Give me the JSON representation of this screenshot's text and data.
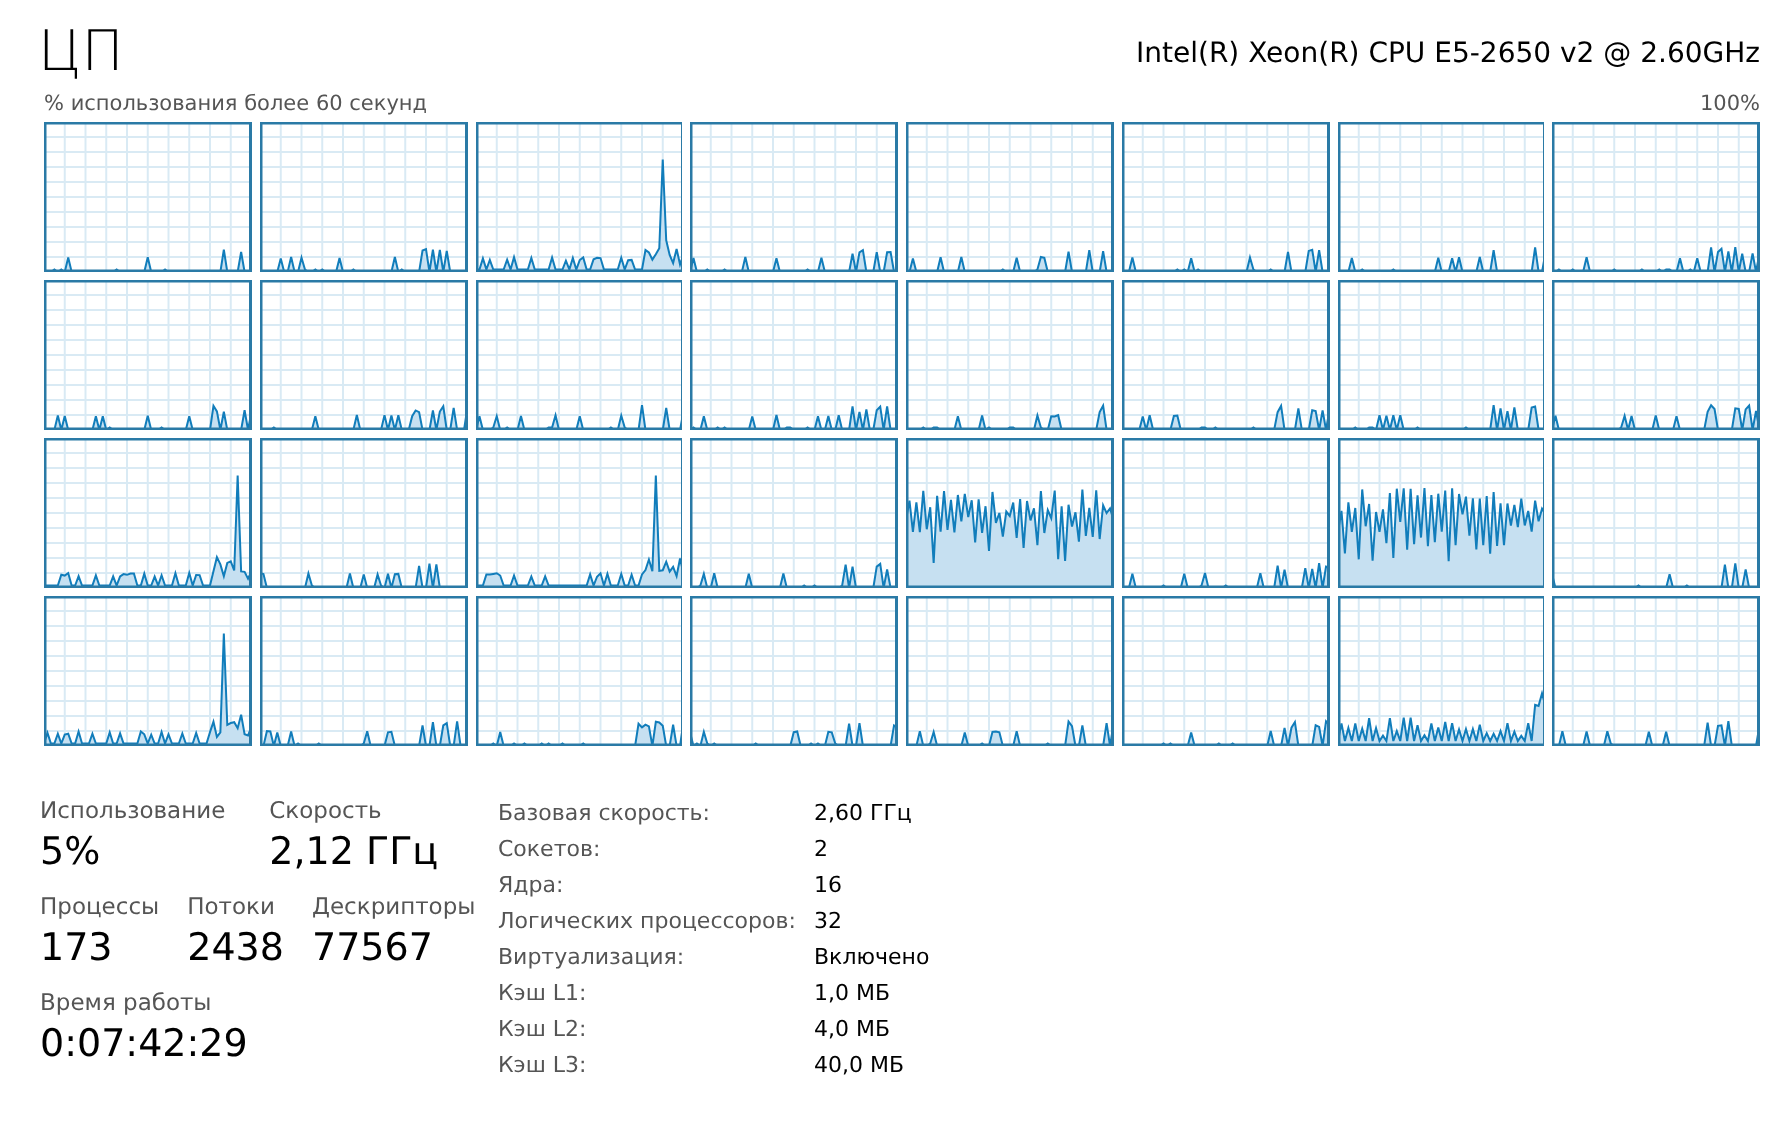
{
  "title": "ЦП",
  "cpu_name": "Intel(R) Xeon(R) CPU E5-2650 v2 @ 2.60GHz",
  "graph_caption": "% использования более 60 секунд",
  "graph_max": "100%",
  "cores": [
    {
      "kind": "quiet"
    },
    {
      "kind": "quiet"
    },
    {
      "kind": "spike"
    },
    {
      "kind": "quiet"
    },
    {
      "kind": "quiet"
    },
    {
      "kind": "quiet"
    },
    {
      "kind": "quiet"
    },
    {
      "kind": "quiet"
    },
    {
      "kind": "quiet"
    },
    {
      "kind": "quiet"
    },
    {
      "kind": "quiet"
    },
    {
      "kind": "quiet"
    },
    {
      "kind": "quiet"
    },
    {
      "kind": "quiet"
    },
    {
      "kind": "quiet"
    },
    {
      "kind": "quiet"
    },
    {
      "kind": "spike"
    },
    {
      "kind": "quiet"
    },
    {
      "kind": "spike"
    },
    {
      "kind": "quiet"
    },
    {
      "kind": "busy"
    },
    {
      "kind": "quiet"
    },
    {
      "kind": "busy"
    },
    {
      "kind": "quiet"
    },
    {
      "kind": "spike"
    },
    {
      "kind": "quiet"
    },
    {
      "kind": "quiet"
    },
    {
      "kind": "quiet"
    },
    {
      "kind": "quiet"
    },
    {
      "kind": "quiet"
    },
    {
      "kind": "ripple"
    },
    {
      "kind": "quiet"
    }
  ],
  "stat_rows": [
    [
      {
        "label": "Использование",
        "value": "5%"
      },
      {
        "label": "Скорость",
        "value": "2,12 ГГц"
      }
    ],
    [
      {
        "label": "Процессы",
        "value": "173"
      },
      {
        "label": "Потоки",
        "value": "2438"
      },
      {
        "label": "Дескрипторы",
        "value": "77567"
      }
    ],
    [
      {
        "label": "Время работы",
        "value": "0:07:42:29"
      }
    ]
  ],
  "details": [
    {
      "label": "Базовая скорость:",
      "value": "2,60 ГГц"
    },
    {
      "label": "Сокетов:",
      "value": "2"
    },
    {
      "label": "Ядра:",
      "value": "16"
    },
    {
      "label": "Логических процессоров:",
      "value": "32"
    },
    {
      "label": "Виртуализация:",
      "value": "Включено"
    },
    {
      "label": "Кэш L1:",
      "value": "1,0 МБ"
    },
    {
      "label": "Кэш L2:",
      "value": "4,0 МБ"
    },
    {
      "label": "Кэш L3:",
      "value": "40,0 МБ"
    }
  ]
}
